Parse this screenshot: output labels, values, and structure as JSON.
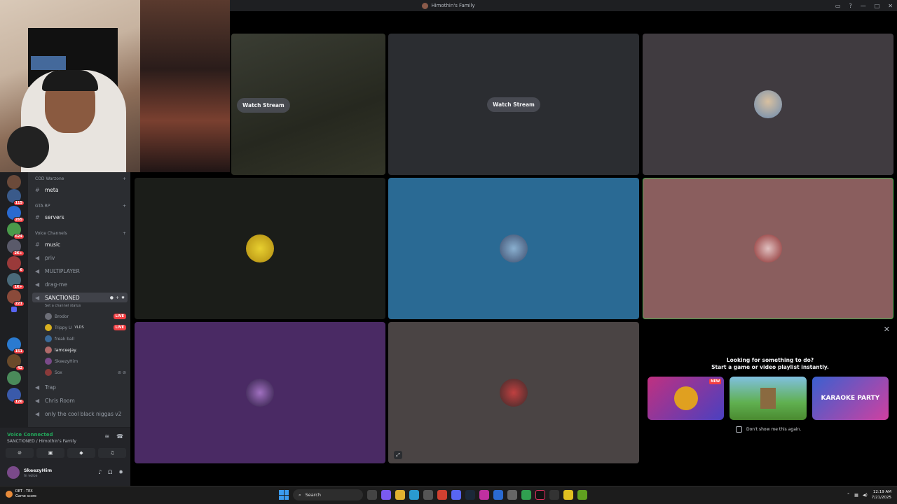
{
  "window": {
    "title": "Himothin's Family",
    "icon": "server-icon"
  },
  "server_rail": {
    "badges": [
      "115",
      "265",
      "624",
      "2K+",
      "6",
      "1K+",
      "221",
      "151",
      "42",
      "126"
    ]
  },
  "channels": {
    "categories": {
      "cod": "COD Warzone",
      "gta": "GTA RP",
      "voice": "Voice Channels"
    },
    "text": {
      "meta": "meta",
      "servers": "servers",
      "music": "music"
    },
    "voice": {
      "priv": "priv",
      "multiplayer": "MULTIPLAYER",
      "drag": "drag-me",
      "sanctioned": "SANCTIONED",
      "sanctioned_status": "Set a channel status",
      "trap": "Trap",
      "chris": "Chris Room",
      "cool": "only the cool black niggas v2"
    },
    "users": [
      {
        "name": "Brodor",
        "live": "LIVE"
      },
      {
        "name": "Trippy U",
        "tag": "VLDS",
        "live": "LIVE"
      },
      {
        "name": "freak ball"
      },
      {
        "name": "lamceejay."
      },
      {
        "name": "SkeezyHim"
      },
      {
        "name": "Sox"
      }
    ]
  },
  "voice_panel": {
    "status": "Voice Connected",
    "location": "SANCTIONED / Himothin's Family"
  },
  "user_panel": {
    "name": "SkeezyHim",
    "status": "In voice"
  },
  "stage": {
    "watch_label_1": "Watch Stream",
    "watch_label_2": "Watch Stream",
    "activity": {
      "line1": "Looking for something to do?",
      "line2": "Start a game or video playlist instantly.",
      "new_badge": "NEW",
      "card3_text": "KARAOKE PARTY",
      "dont_show": "Don't show me this again."
    }
  },
  "taskbar": {
    "weather_title": "DET - TEX",
    "weather_sub": "Game score",
    "search": "Search",
    "time": "12:19 AM",
    "date": "7/21/2025"
  }
}
